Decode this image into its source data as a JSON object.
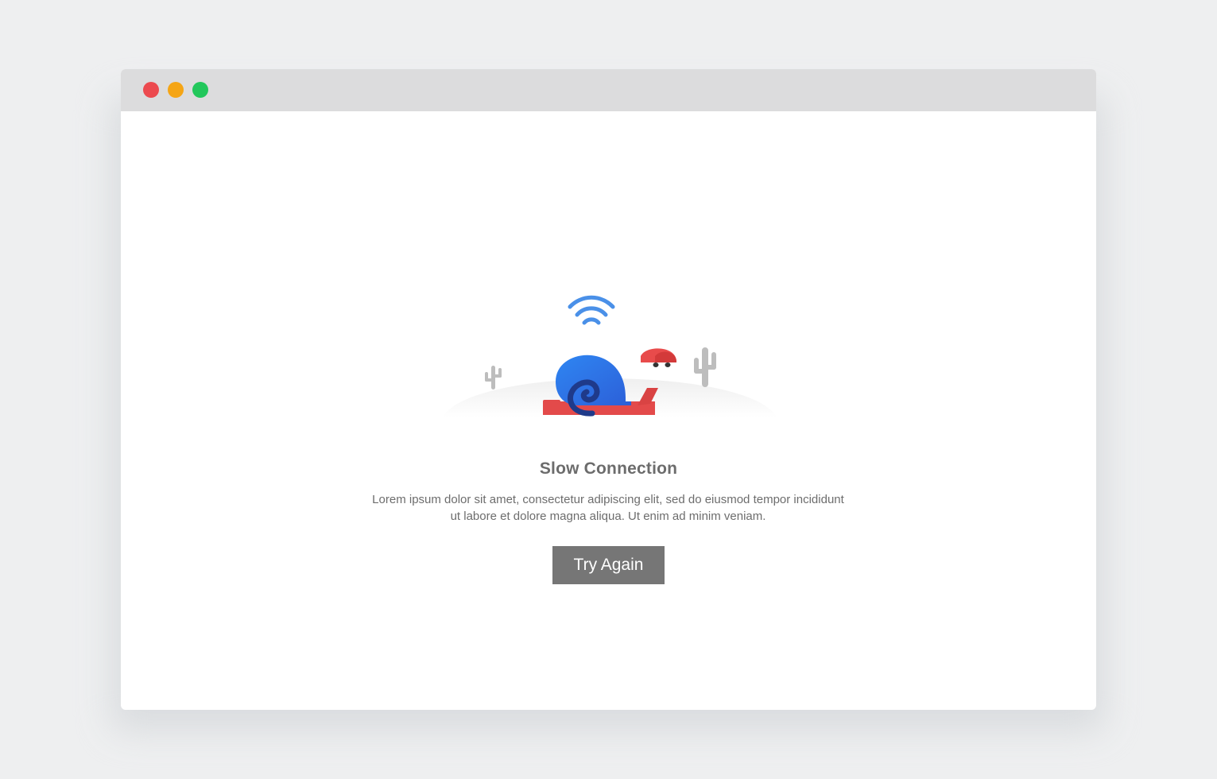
{
  "window": {
    "controls": [
      {
        "name": "close",
        "color": "#ec4a4f"
      },
      {
        "name": "minimize",
        "color": "#f5a515"
      },
      {
        "name": "maximize",
        "color": "#22c75b"
      }
    ]
  },
  "main": {
    "illustration_icon": "slow-connection-snail-icon",
    "title": "Slow Connection",
    "description": "Lorem ipsum dolor sit amet, consectetur adipiscing elit, sed do eiusmod tempor incididunt ut labore et dolore magna aliqua. Ut enim ad minim veniam.",
    "button_label": "Try Again"
  },
  "colors": {
    "background": "#eeeff0",
    "titlebar": "#dcdcdd",
    "button": "#767676",
    "snail_shell": "#3b82f0",
    "snail_body": "#e64949",
    "wifi": "#4a90e8",
    "cactus": "#bdbdbd"
  }
}
